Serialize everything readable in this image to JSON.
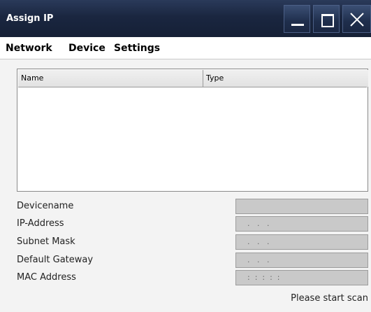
{
  "window": {
    "title": "Assign IP",
    "controls": [
      "minimize-icon",
      "maximize-icon",
      "close-icon"
    ]
  },
  "menu": {
    "items": [
      {
        "label": "Network"
      },
      {
        "label": "Device"
      },
      {
        "label": "Settings"
      }
    ]
  },
  "table": {
    "columns": [
      {
        "label": "Name"
      },
      {
        "label": "Type"
      }
    ],
    "rows": []
  },
  "fields": [
    {
      "label": "Devicename",
      "value": ""
    },
    {
      "label": "IP-Address",
      "value": ".   .   ."
    },
    {
      "label": "Subnet Mask",
      "value": ".   .   ."
    },
    {
      "label": "Default Gateway",
      "value": ".   .   ."
    },
    {
      "label": "MAC Address",
      "value": ":  :  :  :  :"
    }
  ],
  "status": {
    "text": "Please start scan"
  },
  "colors": {
    "titlebar": "#1a2640",
    "field_bg": "#c9c9c9"
  }
}
